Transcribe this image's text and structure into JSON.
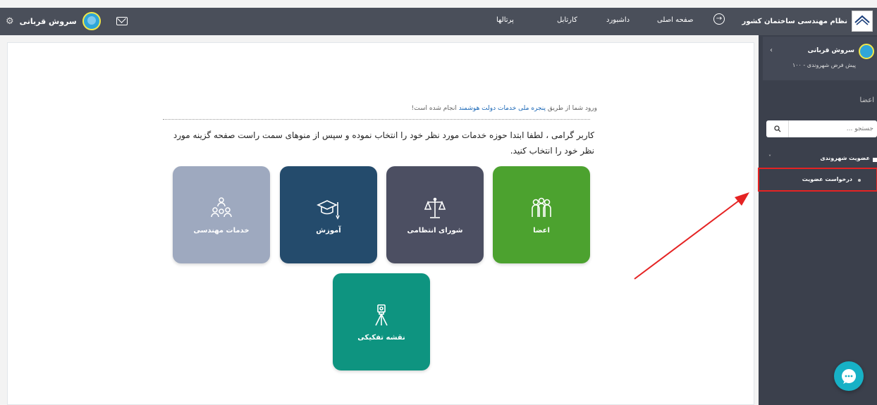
{
  "header": {
    "brand_title": "نظام مهندسی ساختمان کشور",
    "nav": [
      "صفحه اصلی",
      "داشبورد",
      "کارتابل",
      "پرتالها"
    ],
    "username": "سروش قربانی"
  },
  "main": {
    "notice_prefix": "ورود شما از طریق ",
    "notice_link": "پنجره ملی خدمات دولت هوشمند",
    "notice_suffix": " انجام شده است!",
    "instruction": "کاربر گرامی ، لطفا ابتدا حوزه خدمات مورد نظر خود را انتخاب نموده و سپس از منوهای سمت راست صفحه گزینه مورد نظر خود را انتخاب کنید.",
    "tiles": [
      {
        "label": "اعضا",
        "color": "#4ca22f",
        "icon": "members-icon"
      },
      {
        "label": "شورای انتظامی",
        "color": "#4c4f62",
        "icon": "scales-icon"
      },
      {
        "label": "آموزش",
        "color": "#244b6c",
        "icon": "graduation-cap-icon"
      },
      {
        "label": "خدمات مهندسی",
        "color": "#9ea9bf",
        "icon": "engineers-icon"
      },
      {
        "label": "نقشه تفکیکی",
        "color": "#0e9480",
        "icon": "surveyor-icon"
      }
    ]
  },
  "sidebar": {
    "profile_name": "سروش قربانی",
    "profile_sub": "پیش فرض شهروندی - ۱۰۰",
    "section_title": "اعضا",
    "search_placeholder": "جستجو ...",
    "menu_parent": "عضویت شهروندی",
    "menu_child": "درخواست عضویت"
  },
  "colors": {
    "topbar": "#4a4f5a",
    "sidebar": "#3b404c",
    "highlight": "#e52323",
    "chat": "#17b1c6"
  }
}
